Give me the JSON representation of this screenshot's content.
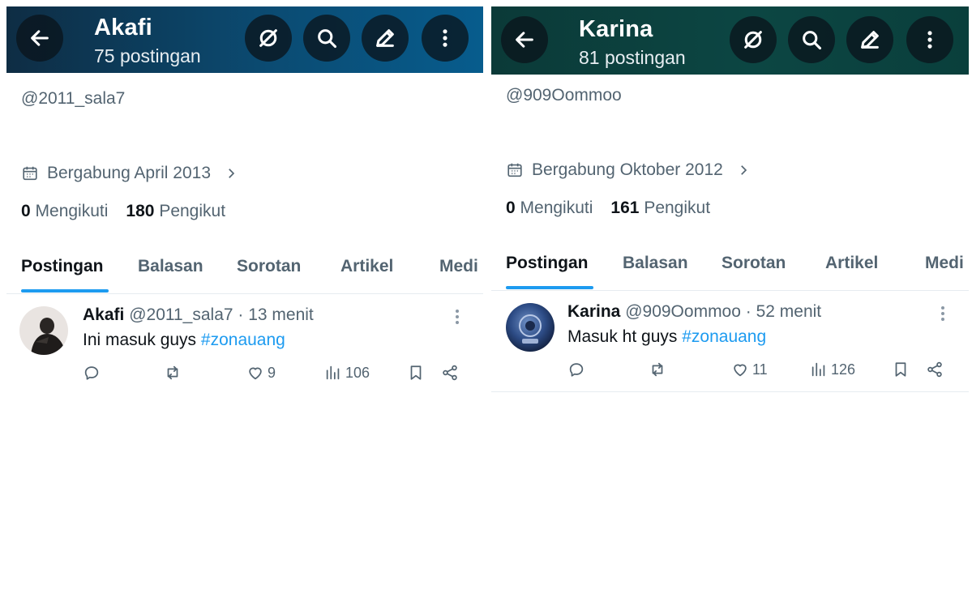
{
  "left": {
    "header": {
      "name": "Akafi",
      "post_count": "75 postingan"
    },
    "profile": {
      "handle": "@2011_sala7",
      "joined": "Bergabung April 2013",
      "following_count": "0",
      "following_label": "Mengikuti",
      "followers_count": "180",
      "followers_label": "Pengikut"
    },
    "tabs": [
      "Postingan",
      "Balasan",
      "Sorotan",
      "Artikel",
      "Medi"
    ],
    "tweet": {
      "name": "Akafi",
      "meta": "@2011_sala7 · 13 menit",
      "text": "Ini masuk guys ",
      "hashtag": "#zonauang",
      "likes": "9",
      "views": "106"
    }
  },
  "right": {
    "header": {
      "name": "Karina",
      "post_count": "81 postingan"
    },
    "profile": {
      "handle": "@909Oommoo",
      "joined": "Bergabung Oktober 2012",
      "following_count": "0",
      "following_label": "Mengikuti",
      "followers_count": "161",
      "followers_label": "Pengikut"
    },
    "tabs": [
      "Postingan",
      "Balasan",
      "Sorotan",
      "Artikel",
      "Medi"
    ],
    "tweet": {
      "name": "Karina",
      "meta": "@909Oommoo · 52 menit",
      "text": "Masuk ht guys ",
      "hashtag": "#zonauang",
      "likes": "11",
      "views": "126"
    }
  },
  "icons": [
    "back-arrow-icon",
    "grok-icon",
    "search-icon",
    "edit-icon",
    "more-vertical-icon",
    "calendar-icon",
    "chevron-right-icon",
    "reply-icon",
    "retweet-icon",
    "like-icon",
    "views-icon",
    "bookmark-icon",
    "share-icon"
  ],
  "colors": {
    "accent": "#1d9bf0",
    "text": "#0f1419",
    "secondary": "#536471"
  }
}
